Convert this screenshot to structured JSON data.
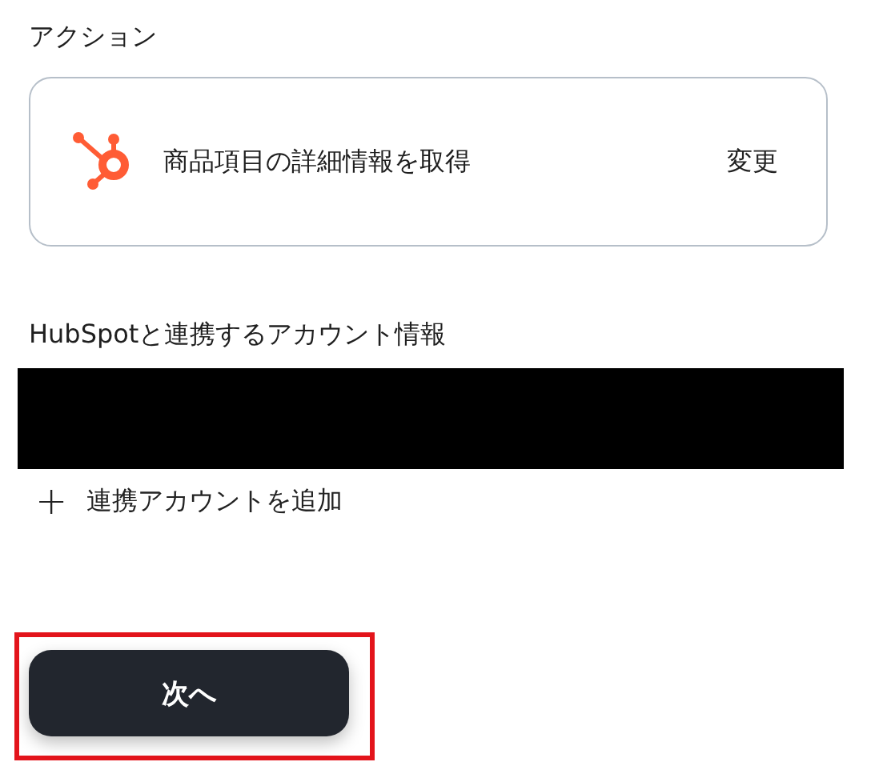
{
  "action_section": {
    "title": "アクション",
    "card": {
      "label": "商品項目の詳細情報を取得",
      "change_link": "変更"
    }
  },
  "account_section": {
    "title": "HubSpotと連携するアカウント情報",
    "account_redacted": true,
    "add_link": {
      "icon": "+",
      "label": "連携アカウントを追加"
    }
  },
  "next_button": {
    "label": "次へ",
    "highlighted": true
  }
}
